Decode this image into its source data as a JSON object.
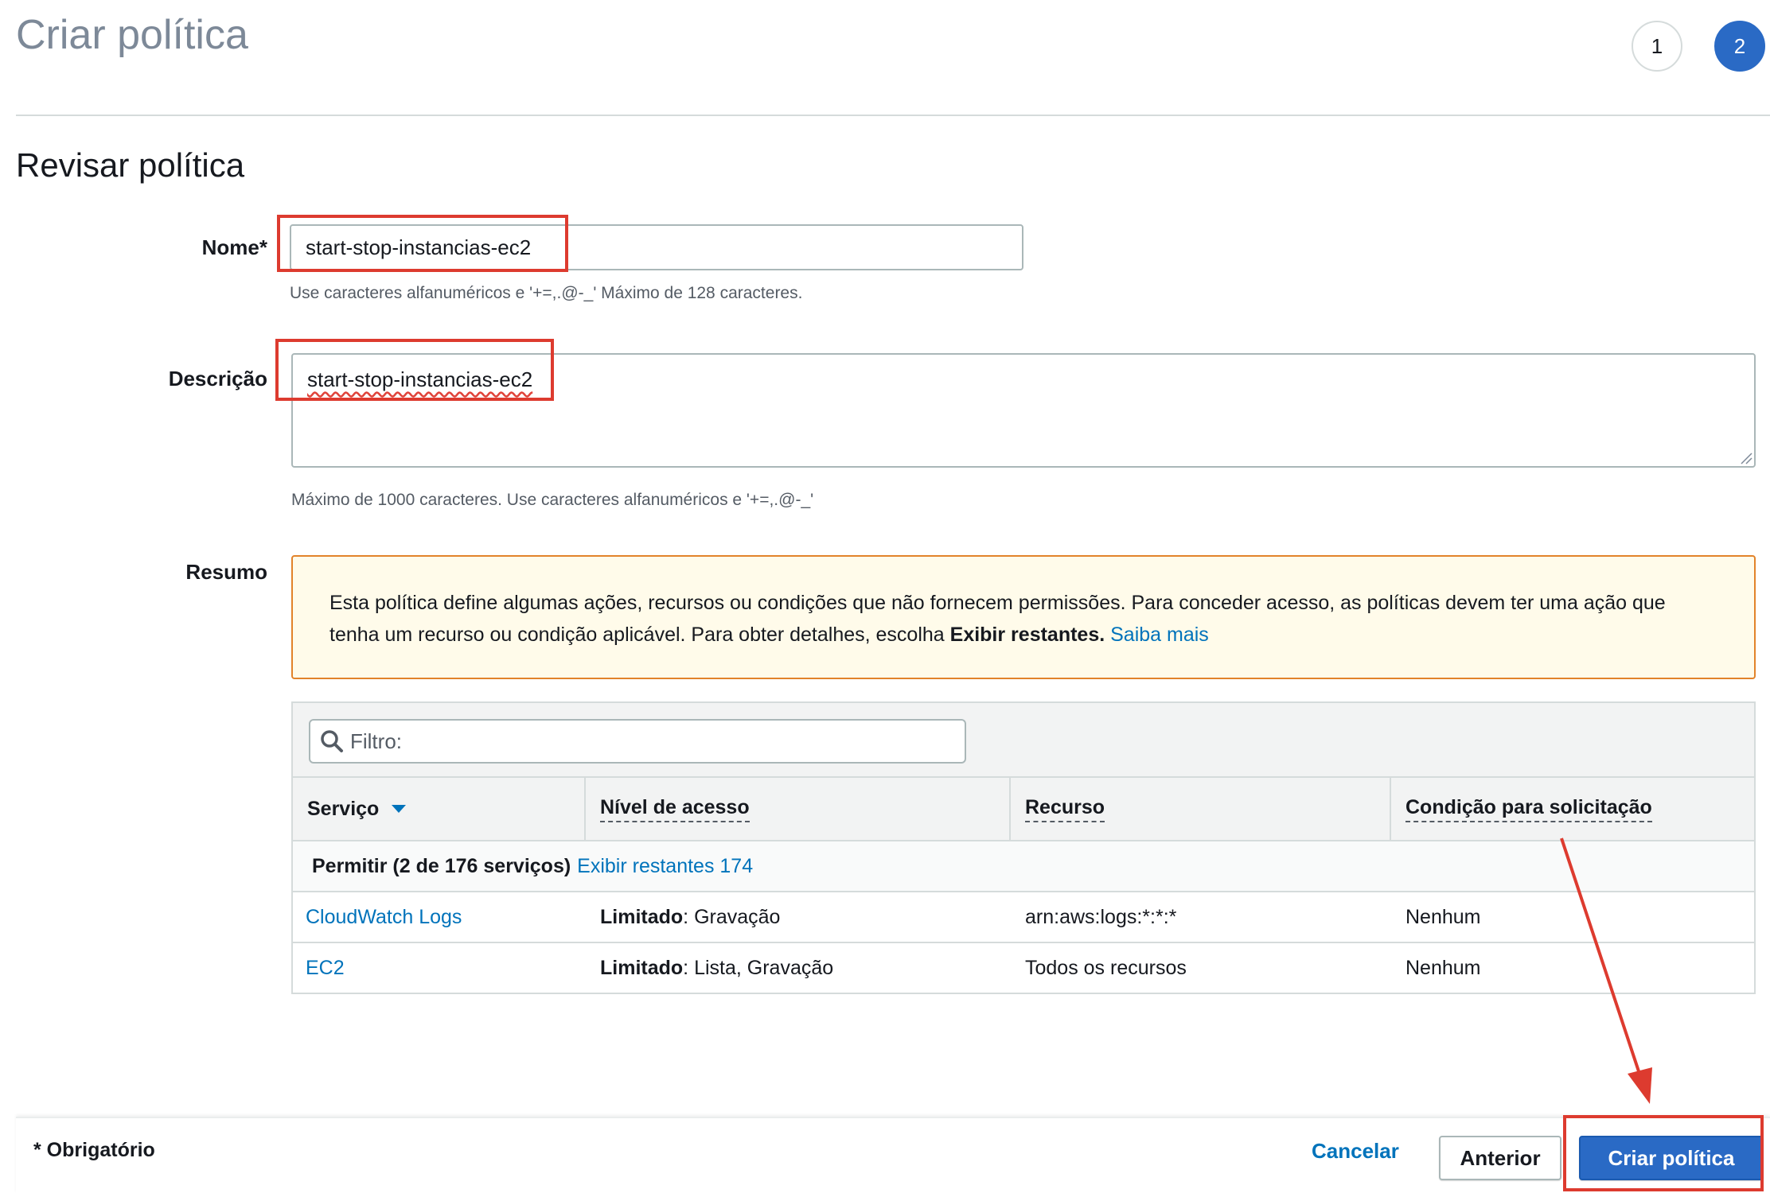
{
  "header": {
    "title": "Criar política",
    "steps": [
      "1",
      "2"
    ],
    "active_step": "2"
  },
  "review": {
    "section_title": "Revisar política",
    "name_label": "Nome*",
    "name_value": "start-stop-instancias-ec2",
    "name_hint": "Use caracteres alfanuméricos e '+=,.@-_' Máximo de 128 caracteres.",
    "description_label": "Descrição",
    "description_value": "start-stop-instancias-ec2",
    "description_hint": "Máximo de 1000 caracteres. Use caracteres alfanuméricos e '+=,.@-_'",
    "summary_label": "Resumo"
  },
  "warning": {
    "text": "Esta política define algumas ações, recursos ou condições que não fornecem permissões. Para conceder acesso, as políticas devem ter uma ação que tenha um recurso ou condição aplicável. Para obter detalhes, escolha ",
    "bold": "Exibir restantes.",
    "link": "Saiba mais"
  },
  "table": {
    "filter_placeholder": "Filtro:",
    "columns": [
      "Serviço",
      "Nível de acesso",
      "Recurso",
      "Condição para solicitação"
    ],
    "group": {
      "label": "Permitir (2 de 176 serviços)",
      "link": "Exibir restantes 174"
    },
    "rows": [
      {
        "service": "CloudWatch Logs",
        "access_level_bold": "Limitado",
        "access_level_rest": ": Gravação",
        "resource": "arn:aws:logs:*:*:*",
        "condition": "Nenhum"
      },
      {
        "service": "EC2",
        "access_level_bold": "Limitado",
        "access_level_rest": ": Lista, Gravação",
        "resource": "Todos os recursos",
        "condition": "Nenhum"
      }
    ]
  },
  "footer": {
    "required_note": "* Obrigatório",
    "cancel": "Cancelar",
    "previous": "Anterior",
    "create": "Criar política"
  },
  "colors": {
    "primary": "#2a6ac5",
    "link": "#0073bb",
    "annotation": "#dd3b2f",
    "warning_border": "#e2832a",
    "warning_bg": "#fffbea"
  }
}
